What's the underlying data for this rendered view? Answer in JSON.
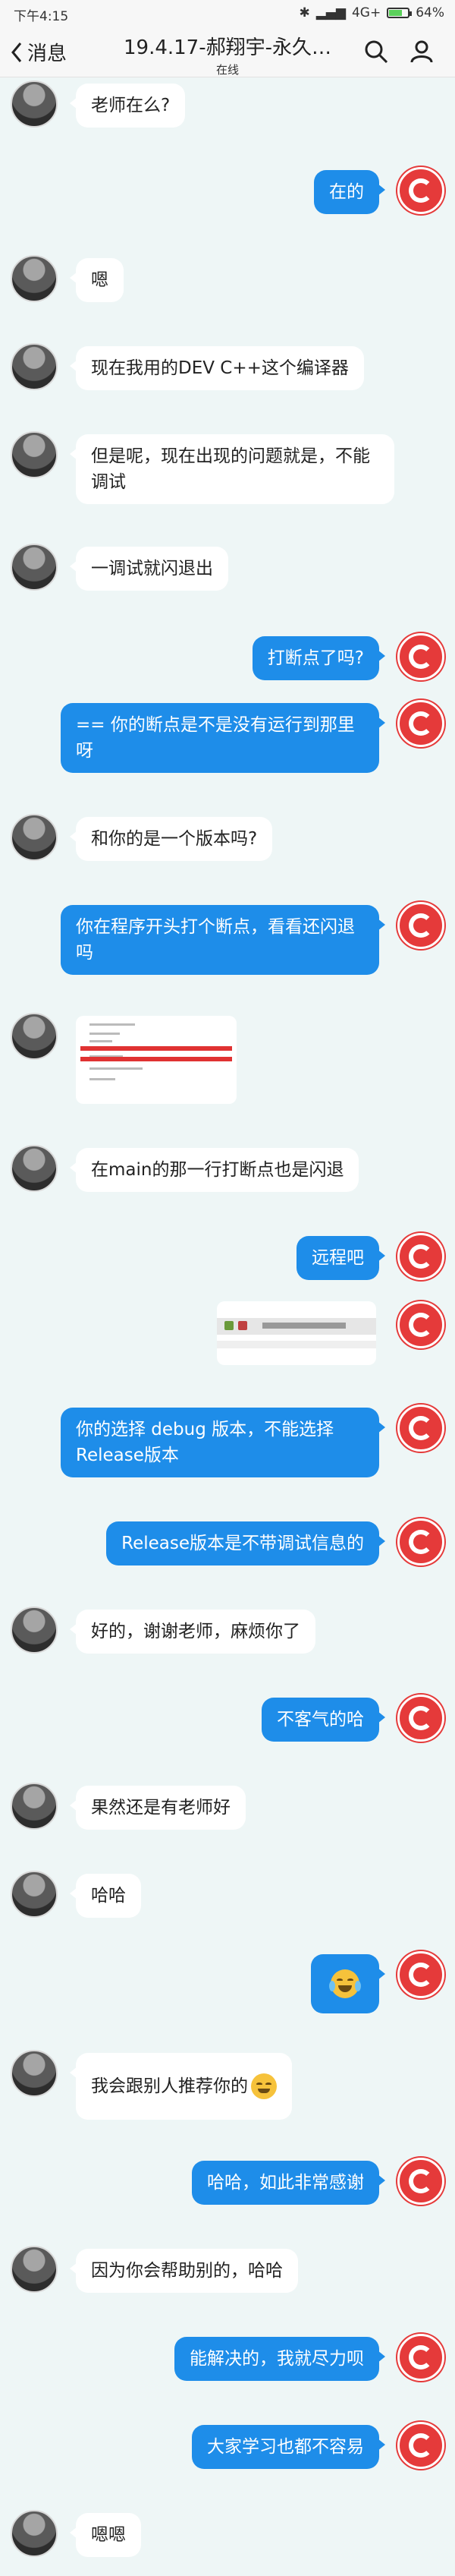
{
  "status_bar": {
    "time": "下午4:15",
    "network": "4G+",
    "battery": "64%"
  },
  "header": {
    "back_label": "消息",
    "title": "19.4.17-郝翔宇-永久…",
    "subtitle": "在线"
  },
  "messages": [
    {
      "side": "left",
      "text": "老师在么?"
    },
    {
      "side": "right",
      "text": "在的"
    },
    {
      "side": "left",
      "text": "嗯"
    },
    {
      "side": "left",
      "text": "现在我用的DEV C++这个编译器"
    },
    {
      "side": "left",
      "text": "但是呢，现在出现的问题就是，不能调试"
    },
    {
      "side": "left",
      "text": "一调试就闪退出"
    },
    {
      "side": "right",
      "text": "打断点了吗?"
    },
    {
      "side": "right",
      "text": "== 你的断点是不是没有运行到那里呀"
    },
    {
      "side": "left",
      "text": "和你的是一个版本吗?"
    },
    {
      "side": "right",
      "text": "你在程序开头打个断点，看看还闪退吗"
    },
    {
      "side": "left",
      "type": "image",
      "text": ""
    },
    {
      "side": "left",
      "text": "在main的那一行打断点也是闪退"
    },
    {
      "side": "right",
      "text": "远程吧"
    },
    {
      "side": "right",
      "type": "image",
      "text": ""
    },
    {
      "side": "right",
      "text": "你的选择 debug 版本，不能选择Release版本"
    },
    {
      "side": "right",
      "text": "Release版本是不带调试信息的"
    },
    {
      "side": "left",
      "text": "好的，谢谢老师，麻烦你了"
    },
    {
      "side": "right",
      "text": "不客气的哈"
    },
    {
      "side": "left",
      "text": "果然还是有老师好"
    },
    {
      "side": "left",
      "text": "哈哈"
    },
    {
      "side": "right",
      "type": "emoji",
      "text": ""
    },
    {
      "side": "left",
      "text": "我会跟别人推荐你的"
    },
    {
      "side": "right",
      "text": "哈哈，如此非常感谢"
    },
    {
      "side": "left",
      "text": "因为你会帮助别的，哈哈"
    },
    {
      "side": "right",
      "text": "能解决的，我就尽力呗"
    },
    {
      "side": "right",
      "text": "大家学习也都不容易"
    },
    {
      "side": "left",
      "text": "嗯嗯"
    }
  ]
}
